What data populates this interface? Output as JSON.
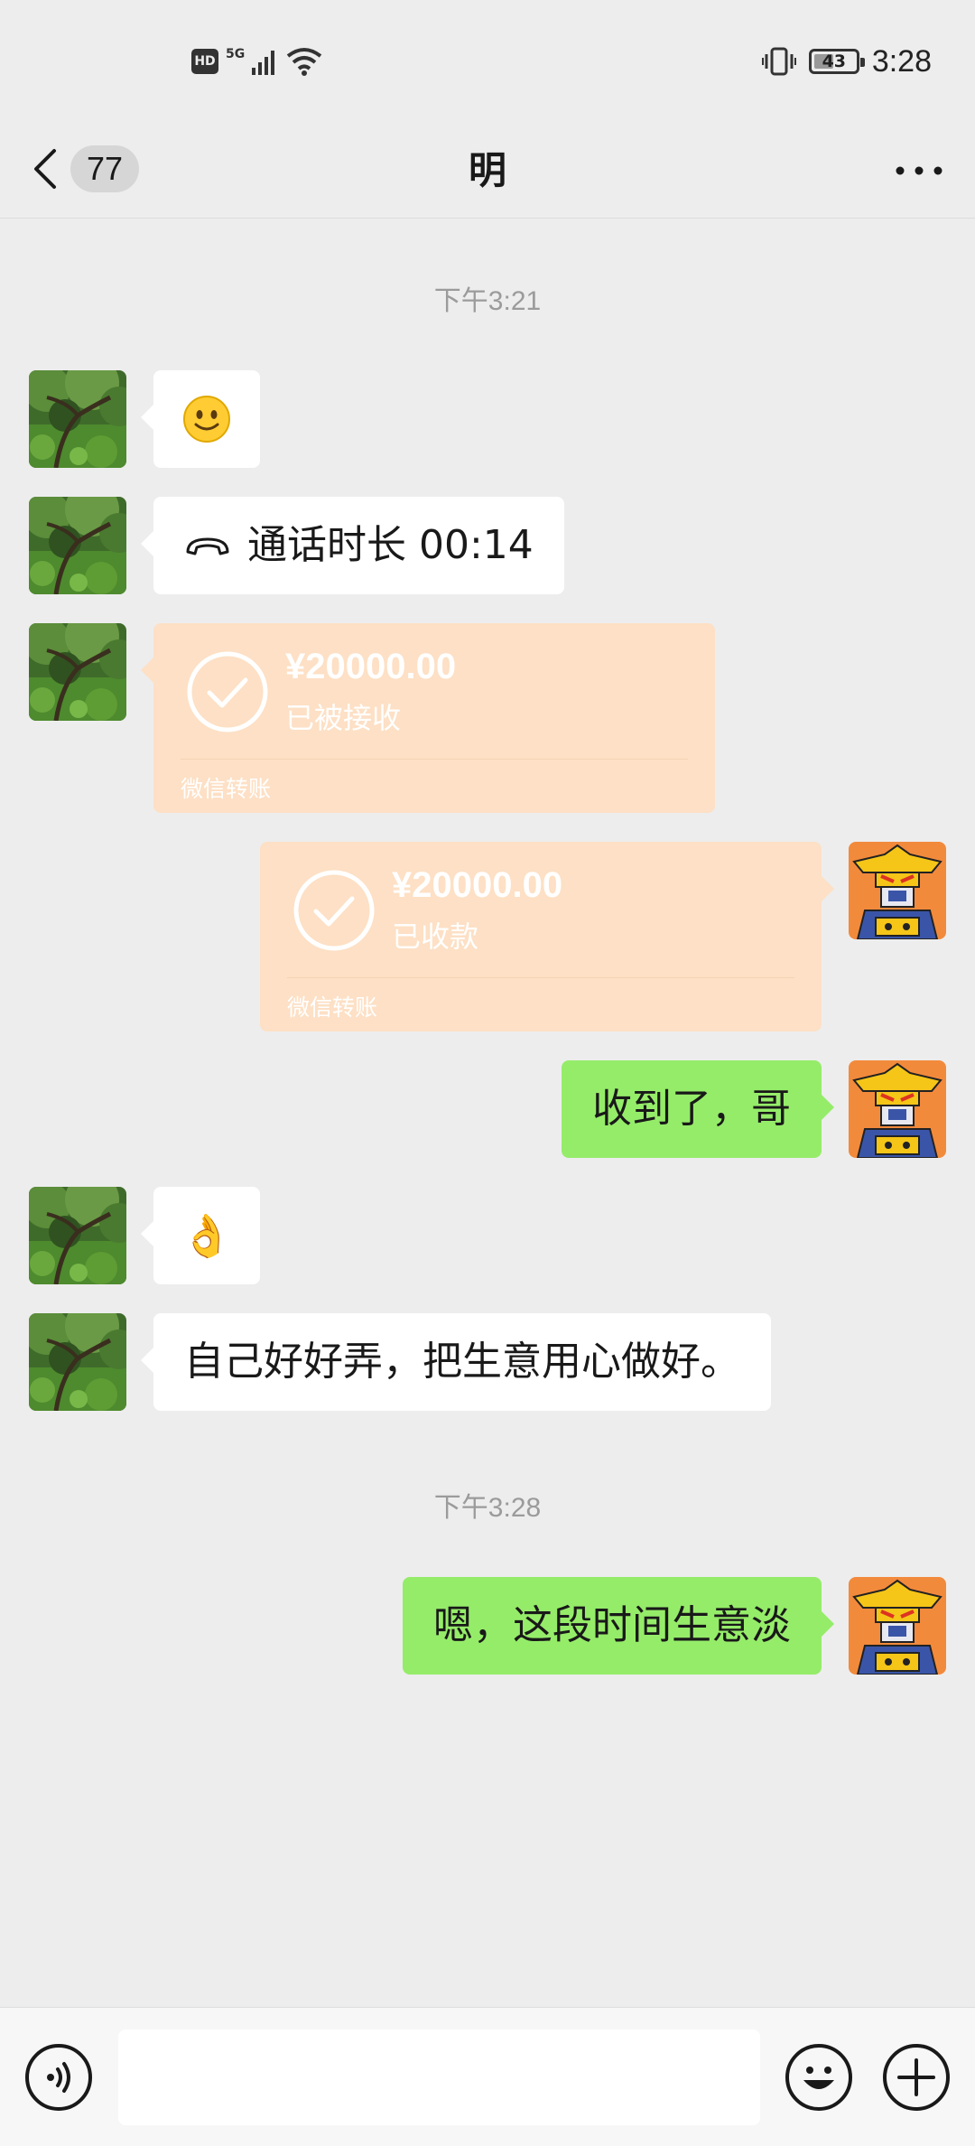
{
  "status_bar": {
    "hd_label": "HD",
    "network_label": "5G",
    "battery_level": "43",
    "time": "3:28"
  },
  "header": {
    "unread_count": "77",
    "title": "明"
  },
  "messages": {
    "timestamp_1": "下午3:21",
    "call_text": "通话时长 00:14",
    "transfer_in": {
      "amount": "¥20000.00",
      "status": "已被接收",
      "label": "微信转账"
    },
    "transfer_out": {
      "amount": "¥20000.00",
      "status": "已收款",
      "label": "微信转账"
    },
    "text_received_ack": "收到了，哥",
    "emoji_ok": "👌",
    "text_advice": "自己好好弄，把生意用心做好。",
    "timestamp_2": "下午3:28",
    "text_reply": "嗯，这段时间生意淡"
  },
  "colors": {
    "background": "#ededed",
    "bubble_self": "#95ec69",
    "bubble_other": "#ffffff",
    "transfer_card": "#fde0c5"
  },
  "icons": {
    "back": "chevron-left-icon",
    "more": "more-dots-icon",
    "voice": "voice-icon",
    "sticker": "smiley-icon",
    "plus": "plus-icon",
    "call": "phone-hangup-icon"
  }
}
